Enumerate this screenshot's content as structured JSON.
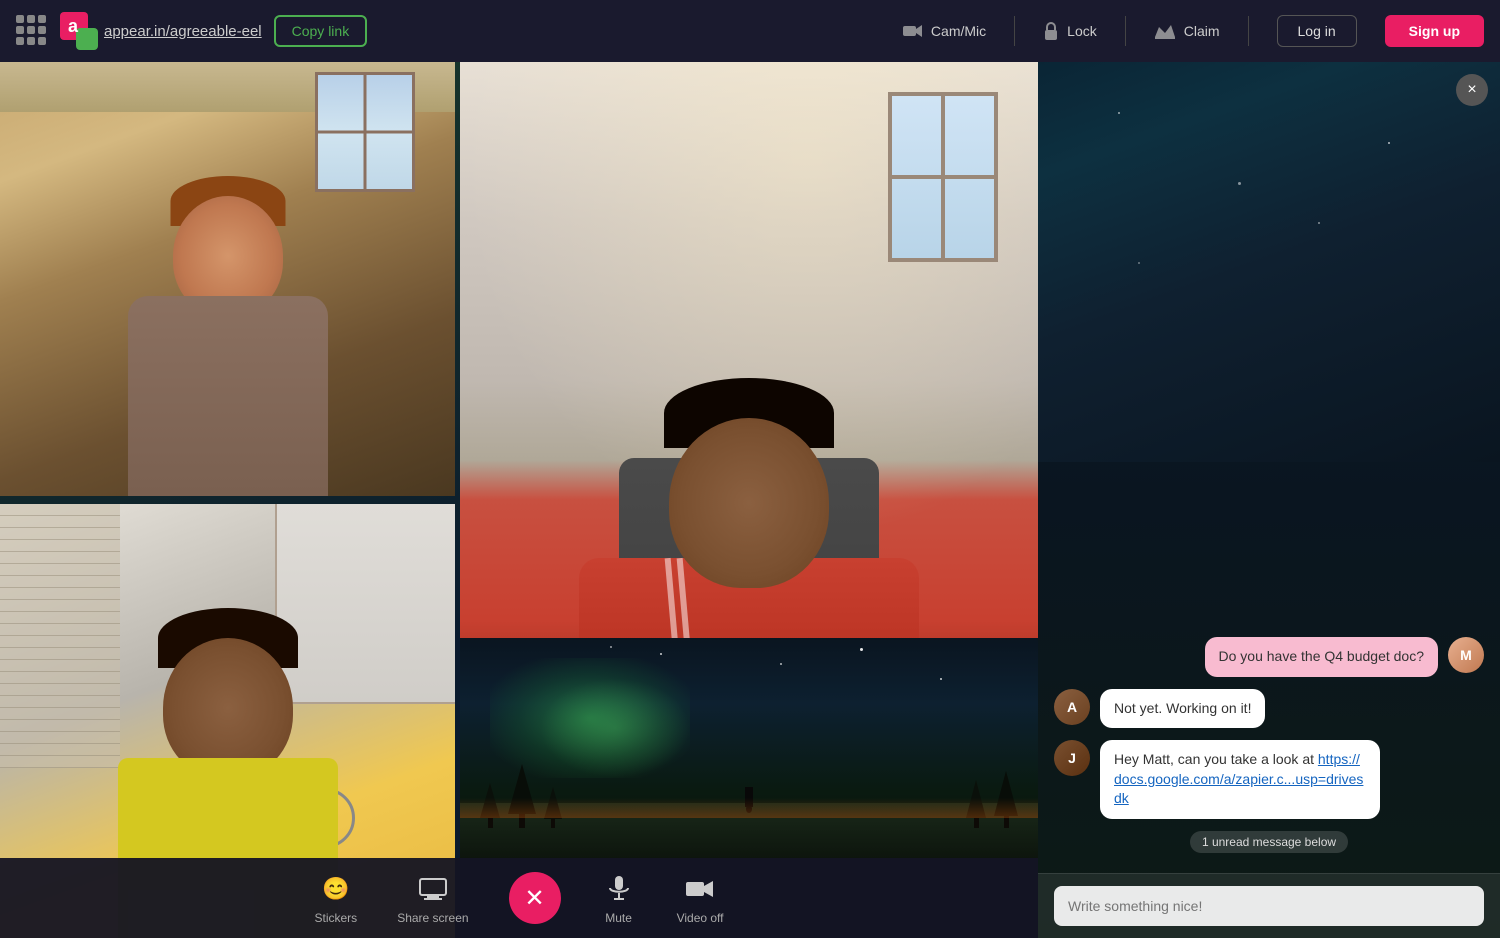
{
  "topnav": {
    "url": "appear.in/agreeable-eel",
    "copy_link_label": "Copy link",
    "cam_mic_label": "Cam/Mic",
    "lock_label": "Lock",
    "claim_label": "Claim",
    "login_label": "Log in",
    "signup_label": "Sign up"
  },
  "toolbar": {
    "stickers_label": "Stickers",
    "share_screen_label": "Share screen",
    "mute_label": "Mute",
    "video_off_label": "Video off"
  },
  "chat": {
    "close_label": "×",
    "messages": [
      {
        "id": 1,
        "text": "Do you have the Q4 budget doc?",
        "type": "outgoing",
        "bubble_class": "pink"
      },
      {
        "id": 2,
        "text": "Not yet. Working on it!",
        "type": "incoming",
        "bubble_class": "white"
      },
      {
        "id": 3,
        "text": "Hey Matt, can you take a look at https://docs.google.com/a/zapier.c...usp=drivesdk",
        "type": "incoming",
        "bubble_class": "white",
        "link_text": "https://docs.google.com/a/zapier.c...usp=drivesdk"
      }
    ],
    "unread_badge": "1 unread message below",
    "input_placeholder": "Write something nice!"
  }
}
